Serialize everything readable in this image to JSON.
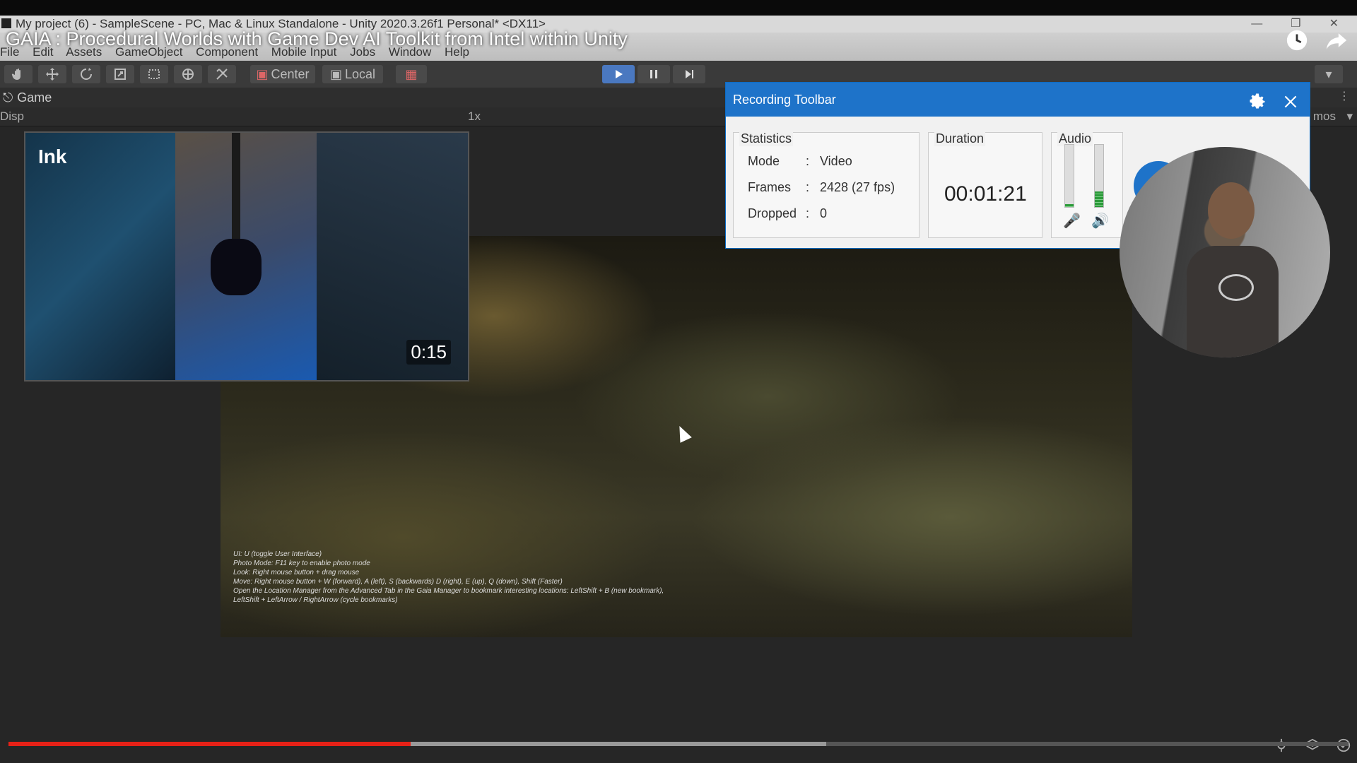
{
  "window": {
    "title": "My project (6) - SampleScene - PC, Mac & Linux Standalone - Unity 2020.3.26f1 Personal* <DX11>"
  },
  "video_title": "GAIA : Procedural Worlds with Game Dev AI Toolkit from Intel within Unity",
  "menu": [
    "File",
    "Edit",
    "Assets",
    "GameObject",
    "Component",
    "Mobile Input",
    "Jobs",
    "Window",
    "Help"
  ],
  "toolbar": {
    "pivot_label": "Center",
    "space_label": "Local"
  },
  "game_tab": {
    "label": "Game",
    "display_label": "Disp",
    "scale_label": "1x",
    "gizmos_label": "mos"
  },
  "recording_toolbar": {
    "title": "Recording Toolbar",
    "statistics_label": "Statistics",
    "duration_label": "Duration",
    "audio_label": "Audio",
    "mode_key": "Mode",
    "mode_value": "Video",
    "frames_key": "Frames",
    "frames_value": "2428 (27 fps)",
    "dropped_key": "Dropped",
    "dropped_value": "0",
    "separator": ":",
    "duration_value": "00:01:21",
    "mic_level": 0.05,
    "speaker_level": 0.25
  },
  "ink_preview": {
    "title": "Ink",
    "time": "0:15"
  },
  "game_help_lines": [
    "UI: U (toggle User Interface)",
    "Photo Mode: F11 key to enable photo mode",
    "Look: Right mouse button + drag mouse",
    "Move: Right mouse button + W (forward), A (left), S (backwards) D (right), E (up), Q (down), Shift (Faster)",
    "Open the Location Manager from the Advanced Tab in the Gaia Manager to bookmark interesting locations: LeftShift + B (new bookmark),",
    "LeftShift + LeftArrow / RightArrow (cycle bookmarks)"
  ],
  "playback": {
    "played_fraction": 0.3,
    "buffered_fraction": 0.61
  },
  "colors": {
    "accent_blue": "#1e73c9",
    "progress_red": "#e62117"
  }
}
